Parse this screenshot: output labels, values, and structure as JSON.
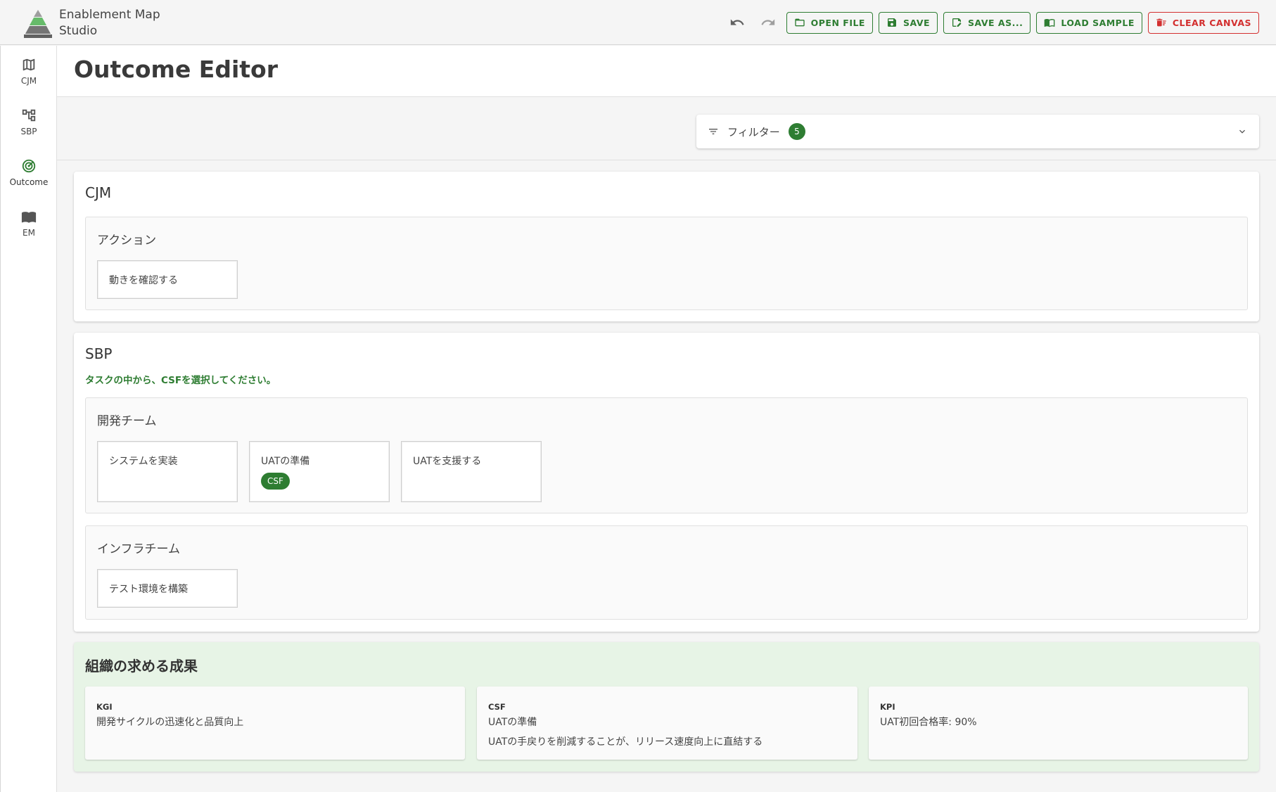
{
  "app": {
    "title_line1": "Enablement Map",
    "title_line2": "Studio"
  },
  "toolbar": {
    "open_file": "OPEN FILE",
    "save": "SAVE",
    "save_as": "SAVE AS...",
    "load_sample": "LOAD SAMPLE",
    "clear_canvas": "CLEAR CANVAS"
  },
  "sidebar": {
    "items": [
      {
        "label": "CJM",
        "icon": "map-icon"
      },
      {
        "label": "SBP",
        "icon": "hierarchy-icon"
      },
      {
        "label": "Outcome",
        "icon": "target-icon",
        "active": true
      },
      {
        "label": "EM",
        "icon": "book-icon"
      }
    ]
  },
  "page": {
    "title": "Outcome Editor"
  },
  "filter": {
    "label": "フィルター",
    "count": "5"
  },
  "cjm": {
    "title": "CJM",
    "group_title": "アクション",
    "actions": [
      "動きを確認する"
    ]
  },
  "sbp": {
    "title": "SBP",
    "hint": "タスクの中から、CSFを選択してください。",
    "lanes": [
      {
        "title": "開発チーム",
        "tasks": [
          {
            "label": "システムを実装"
          },
          {
            "label": "UATの準備",
            "chip": "CSF"
          },
          {
            "label": "UATを支援する"
          }
        ]
      },
      {
        "title": "インフラチーム",
        "tasks": [
          {
            "label": "テスト環境を構築"
          }
        ]
      }
    ]
  },
  "outcome": {
    "title": "組織の求める成果",
    "kgi": {
      "kind": "KGI",
      "text": "開発サイクルの迅速化と品質向上"
    },
    "csf": {
      "kind": "CSF",
      "text": "UATの準備",
      "sub": "UATの手戻りを削減することが、リリース速度向上に直結する"
    },
    "kpi": {
      "kind": "KPI",
      "text": "UAT初回合格率: 90%"
    }
  },
  "colors": {
    "accent": "#2e7d32",
    "danger": "#d32f2f",
    "outcome_bg": "#e7f4e6"
  }
}
